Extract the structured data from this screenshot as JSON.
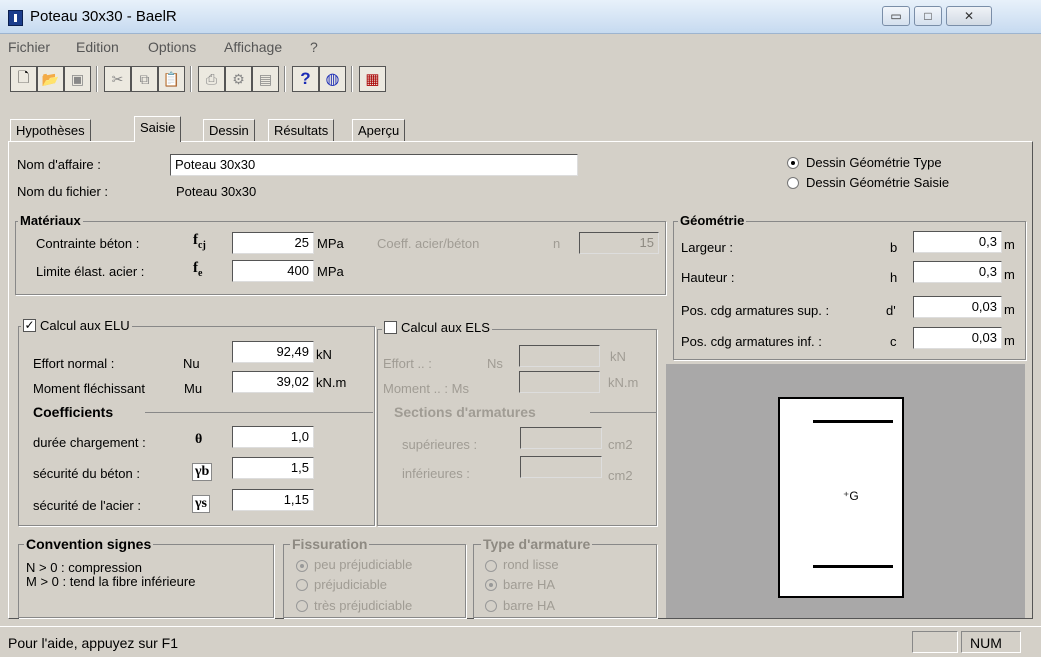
{
  "window": {
    "title": "Poteau 30x30 - BaelR",
    "min": "▭",
    "max": "□",
    "close": "✕"
  },
  "menu": [
    "Fichier",
    "Edition",
    "Options",
    "Affichage",
    "?"
  ],
  "toolbar_icons": [
    "new-file-icon",
    "open-folder-icon",
    "save-icon",
    "cut-icon",
    "copy-icon",
    "paste-icon",
    "print-icon",
    "print-setup-icon",
    "preview-icon",
    "help-icon",
    "color-wheel-icon",
    "calculator-icon"
  ],
  "tabs": [
    "Hypothèses",
    "Saisie",
    "Dessin",
    "Résultats",
    "Aperçu"
  ],
  "affaire": {
    "label": "Nom d'affaire :",
    "value": "Poteau 30x30",
    "file_label": "Nom du fichier :",
    "file_value": "Poteau 30x30"
  },
  "drawing_mode": {
    "opt1": "Dessin Géométrie Type",
    "opt2": "Dessin Géométrie Saisie",
    "selected": "opt1"
  },
  "materiaux": {
    "title": "Matériaux",
    "beton_label": "Contrainte béton :",
    "beton_sym": "f",
    "beton_sub": "cj",
    "beton_value": "25",
    "beton_unit": "MPa",
    "acier_label": "Limite élast. acier :",
    "acier_sym": "f",
    "acier_sub": "e",
    "acier_value": "400",
    "acier_unit": "MPa",
    "coeff_label": "Coeff. acier/béton",
    "coeff_sym": "n",
    "coeff_value": "15"
  },
  "geometrie": {
    "title": "Géométrie",
    "largeur_label": "Largeur :",
    "largeur_sym": "b",
    "largeur_value": "0,3",
    "largeur_unit": "m",
    "hauteur_label": "Hauteur :",
    "hauteur_sym": "h",
    "hauteur_value": "0,3",
    "hauteur_unit": "m",
    "sup_label": "Pos. cdg armatures sup. :",
    "sup_sym": "d'",
    "sup_value": "0,03",
    "sup_unit": "m",
    "inf_label": "Pos. cdg armatures inf. :",
    "inf_sym": "c",
    "inf_value": "0,03",
    "inf_unit": "m"
  },
  "elu": {
    "title": "Calcul aux ELU",
    "checked": true,
    "check_glyph": "✓",
    "effort_label": "Effort normal :",
    "effort_sym": "Nu",
    "effort_value": "92,49",
    "effort_unit": "kN",
    "moment_label": "Moment fléchissant",
    "moment_sym": "Mu",
    "moment_value": "39,02",
    "moment_unit": "kN.m"
  },
  "coefficients": {
    "title": "Coefficients",
    "duree_label": "durée chargement :",
    "duree_sym": "θ",
    "duree_value": "1,0",
    "beton_label": "sécurité du béton :",
    "beton_sym": "γb",
    "beton_value": "1,5",
    "acier_label": "sécurité de l'acier :",
    "acier_sym": "γs",
    "acier_value": "1,15"
  },
  "els": {
    "title": "Calcul aux ELS",
    "checked": false,
    "effort_label": "Effort .. :",
    "effort_sym": "Ns",
    "effort_unit": "kN",
    "moment_label": "Moment .. : Ms",
    "moment_unit": "kN.m"
  },
  "sections": {
    "title": "Sections d'armatures",
    "sup_label": "supérieures :",
    "sup_unit": "cm2",
    "inf_label": "inférieures :",
    "inf_unit": "cm2"
  },
  "convention": {
    "title": "Convention signes",
    "line1": "N > 0 : compression",
    "line2": "M > 0 : tend la fibre inférieure"
  },
  "fissuration": {
    "title": "Fissuration",
    "opt1": "peu préjudiciable",
    "opt2": "préjudiciable",
    "opt3": "très préjudiciable",
    "selected": "opt1"
  },
  "armature": {
    "title": "Type d'armature",
    "opt1": "rond lisse",
    "opt2": "barre HA",
    "opt3": "barre HA",
    "selected": "opt2"
  },
  "preview": {
    "center_label": "G"
  },
  "status": {
    "text": "Pour l'aide, appuyez sur F1",
    "num": "NUM"
  }
}
